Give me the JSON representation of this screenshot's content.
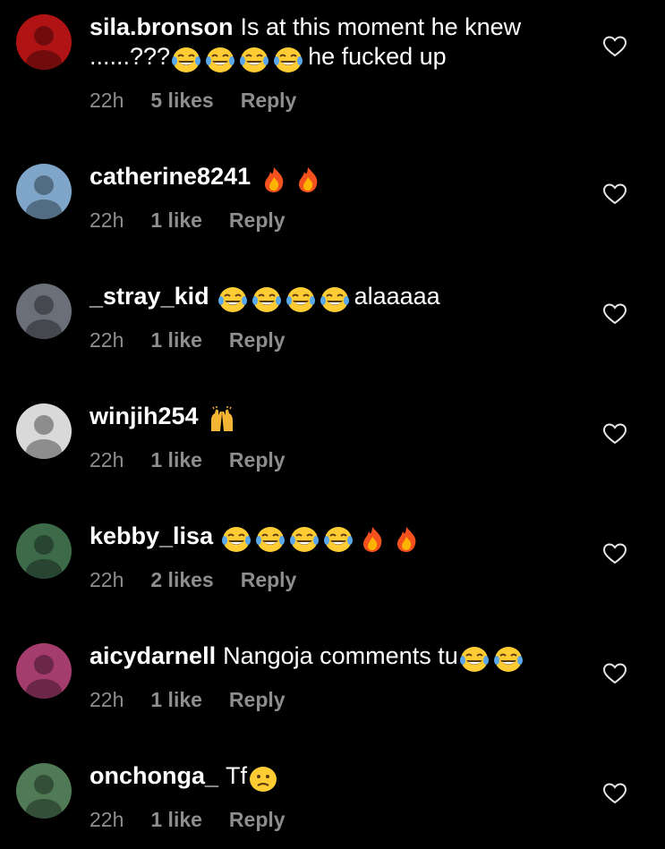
{
  "comments": [
    {
      "username": "sila.bronson",
      "text_before": "Is at this moment he knew ......???",
      "emojis": [
        "laughing-crying-emoji",
        "laughing-crying-emoji",
        "laughing-crying-emoji",
        "laughing-crying-emoji"
      ],
      "text_after": "he fucked up",
      "time": "22h",
      "likes": "5 likes",
      "reply": "Reply",
      "avatar_color": "#b01313"
    },
    {
      "username": "catherine8241",
      "text_before": "",
      "emojis": [
        "fire-emoji",
        "fire-emoji"
      ],
      "text_after": "",
      "time": "22h",
      "likes": "1 like",
      "reply": "Reply",
      "avatar_color": "#7fa6c9"
    },
    {
      "username": "_stray_kid",
      "text_before": "",
      "emojis": [
        "laughing-crying-emoji",
        "laughing-crying-emoji",
        "laughing-crying-emoji",
        "laughing-crying-emoji"
      ],
      "text_after": "alaaaaa",
      "time": "22h",
      "likes": "1 like",
      "reply": "Reply",
      "avatar_color": "#6b6f7a"
    },
    {
      "username": "winjih254",
      "text_before": "",
      "emojis": [
        "raising-hands-emoji"
      ],
      "text_after": "",
      "time": "22h",
      "likes": "1 like",
      "reply": "Reply",
      "avatar_color": "#d9d9d9"
    },
    {
      "username": "kebby_lisa",
      "text_before": "",
      "emojis": [
        "laughing-crying-emoji",
        "laughing-crying-emoji",
        "laughing-crying-emoji",
        "laughing-crying-emoji",
        "fire-emoji",
        "fire-emoji"
      ],
      "text_after": "",
      "time": "22h",
      "likes": "2 likes",
      "reply": "Reply",
      "avatar_color": "#3d6b4a"
    },
    {
      "username": "aicydarnell",
      "text_before": "Nangoja comments tu",
      "emojis": [
        "laughing-crying-emoji",
        "laughing-crying-emoji"
      ],
      "text_after": "",
      "time": "22h",
      "likes": "1 like",
      "reply": "Reply",
      "avatar_color": "#a43c6e"
    },
    {
      "username": "onchonga_",
      "text_before": "Tf",
      "emojis": [
        "confused-face-emoji"
      ],
      "text_after": "",
      "time": "22h",
      "likes": "1 like",
      "reply": "Reply",
      "avatar_color": "#4f7a55"
    }
  ],
  "colors": {
    "background": "#000000",
    "text": "#ffffff",
    "muted": "#8e8e8e"
  }
}
